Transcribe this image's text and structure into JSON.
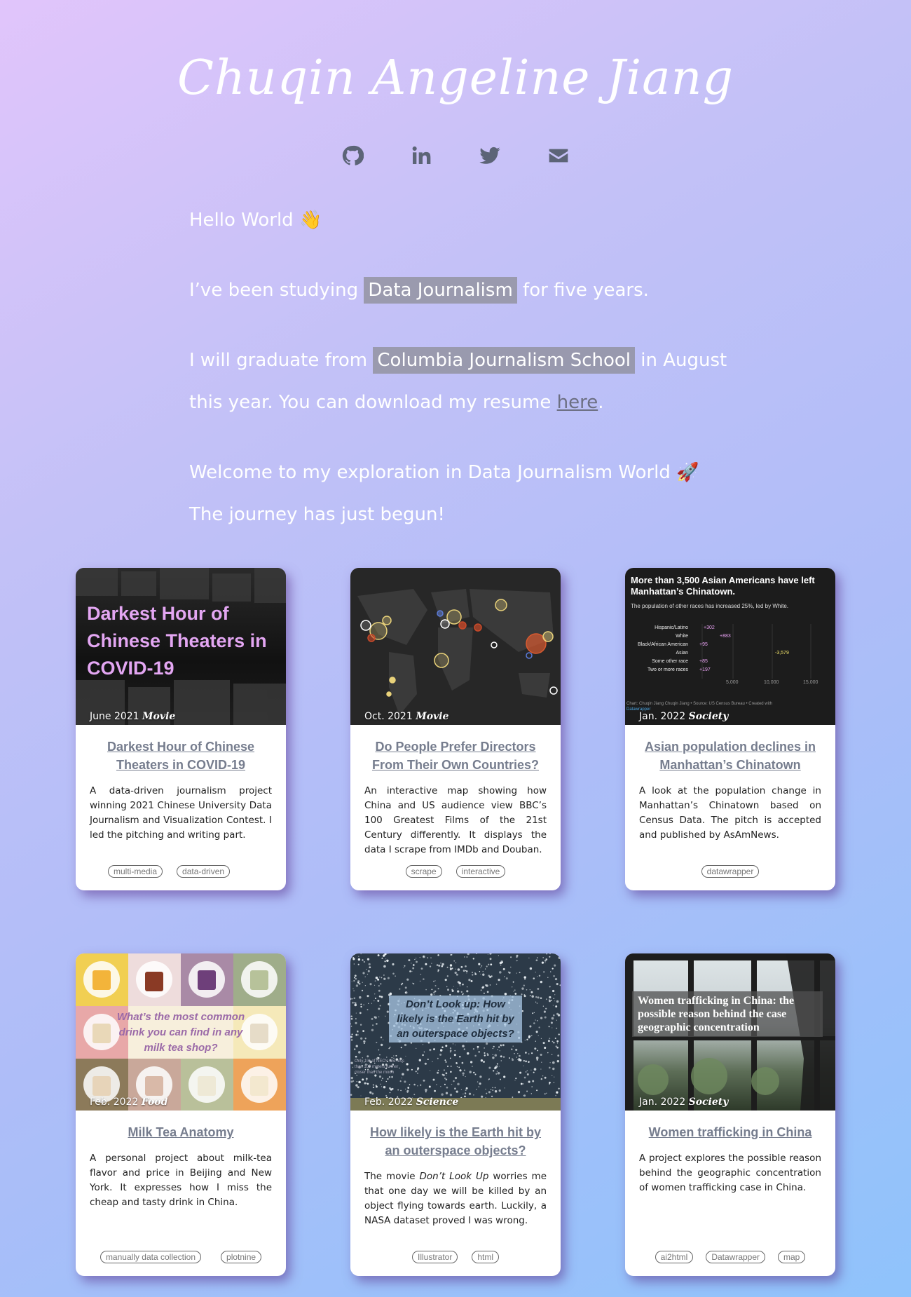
{
  "header": {
    "name": "Chuqin Angeline Jiang"
  },
  "social": [
    "github-icon",
    "linkedin-icon",
    "twitter-icon",
    "envelope-icon"
  ],
  "intro": {
    "hello": "Hello World 👋",
    "p2_pre": "I’ve been studying ",
    "p2_hl": "Data Journalism",
    "p2_post": " for five years.",
    "p3_pre": "I will graduate from ",
    "p3_hl": "Columbia Journalism School",
    "p3_mid": " in August this year. You can download my resume ",
    "p3_link": "here",
    "p3_post": ".",
    "p4": "Welcome to my exploration in Data Journalism World 🚀 The journey has just begun!"
  },
  "cards": [
    {
      "date": "June 2021",
      "category": "Movie",
      "thumb_text": "Darkest Hour of Chinese Theaters in COVID-19",
      "title": "Darkest Hour of Chinese Theaters in COVID-19",
      "desc": "A data-driven journalism project winning 2021 Chinese University Data Journalism and Visualization Contest. I led the pitching and writing part.",
      "tags": [
        "multi-media",
        "data-driven"
      ]
    },
    {
      "date": "Oct. 2021",
      "category": "Movie",
      "title": "Do People Prefer Directors From Their Own Countries?",
      "desc": "An interactive map showing how China and US audience view BBC’s 100 Greatest Films of the 21st Century differently. It displays the data I scrape from IMDb and Douban.",
      "tags": [
        "scrape",
        "interactive"
      ]
    },
    {
      "date": "Jan. 2022",
      "category": "Society",
      "thumb_title": "More than 3,500 Asian Americans have left Manhattan’s Chinatown.",
      "thumb_sub": "The population of other races has increased 25%, led by White.",
      "thumb_rows": [
        {
          "label": "Hispanic/Latino",
          "value": "+302"
        },
        {
          "label": "White",
          "value": "+883"
        },
        {
          "label": "Black/African American",
          "value": "+95"
        },
        {
          "label": "Asian",
          "value": "-3,579"
        },
        {
          "label": "Some other race",
          "value": "+85"
        },
        {
          "label": "Two or more races",
          "value": "+197"
        }
      ],
      "thumb_ticks": [
        "5,000",
        "10,000",
        "15,000"
      ],
      "thumb_source": "Chart: Chuqin Jiang Chuqin Jiang • Source: US Census Bureau • Created with",
      "thumb_dw": "Datawrapper",
      "title": "Asian population declines in Manhattan’s Chinatown",
      "desc": "A look at the population change in Manhattan’s Chinatown based on Census Data. The pitch is accepted and published by AsAmNews.",
      "tags": [
        "datawrapper"
      ]
    },
    {
      "date": "Feb. 2022",
      "category": "Food",
      "thumb_text": "What’s the most common drink you can find in any milk tea shop?",
      "title": "Milk Tea Anatomy",
      "desc": "A personal project about milk-tea flavor and price in Beijing and New York. It expresses how I miss the cheap and tasty drink in China.",
      "tags": [
        "manually data collection",
        "plotnine"
      ]
    },
    {
      "date": "Feb. 2022",
      "category": "Science",
      "thumb_text": "Don’t Look up: How likely is the Earth hit by an outerspace objects?",
      "thumb_small": "Only 1% of NEO's are less than 100 meters further closer than the moon",
      "title": "How likely is the Earth hit by an outerspace objects?",
      "desc_pre": "The movie ",
      "desc_em": "Don’t Look Up",
      "desc_post": " worries me that one day we will be killed by an object flying towards earth. Luckily, a NASA dataset proved I was wrong.",
      "tags": [
        "Illustrator",
        "html"
      ]
    },
    {
      "date": "Jan. 2022",
      "category": "Society",
      "thumb_text": "Women trafficking in China: the possible reason behind the case geographic concentration",
      "title": "Women trafficking in China",
      "desc": "A project explores the possible reason behind the geographic concentration of women trafficking case in China.",
      "tags": [
        "ai2html",
        "Datawrapper",
        "map"
      ]
    }
  ]
}
